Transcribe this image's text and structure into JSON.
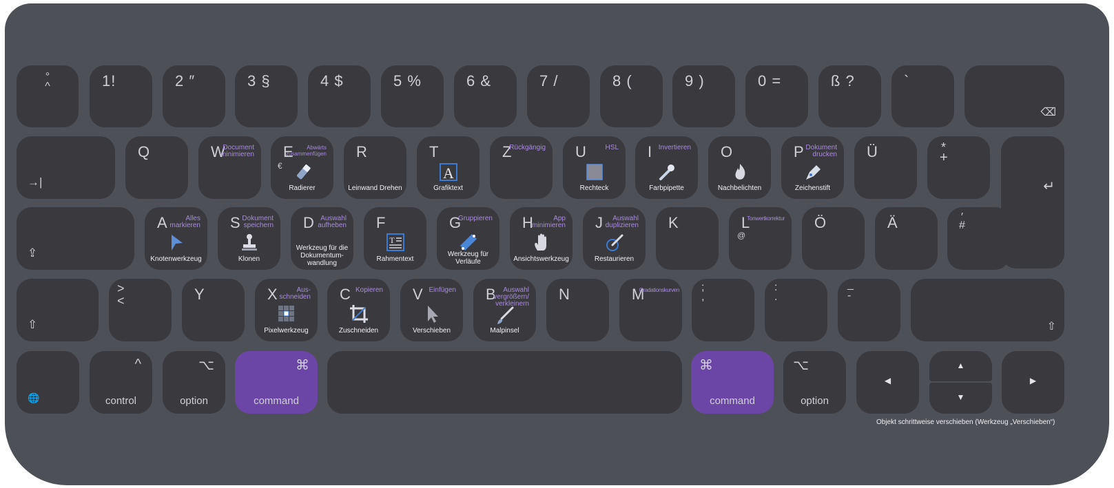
{
  "keys": {
    "circ": {
      "top": "°",
      "bottom": "^"
    },
    "k1": "1!",
    "k2": "2 ″",
    "k3": "3 §",
    "k4": "4 $",
    "k5": "5 %",
    "k6": "6 &",
    "k7": "7 /",
    "k8": "8 (",
    "k9": "9 )",
    "k0": "0 =",
    "kss": "ß ?",
    "kacc": "`",
    "q": "Q",
    "w": {
      "cap": "W",
      "shortcut": "Document\nminimieren"
    },
    "e": {
      "cap": "E",
      "shortcut": "Abwärts\nzusammenfügen",
      "alt": "€",
      "tool": "Radierer"
    },
    "r": {
      "cap": "R",
      "tool": "Leinwand Drehen"
    },
    "t": {
      "cap": "T",
      "tool": "Grafiktext"
    },
    "z": {
      "cap": "Z",
      "shortcut": "Rückgängig"
    },
    "u": {
      "cap": "U",
      "shortcut": "HSL",
      "tool": "Rechteck"
    },
    "i": {
      "cap": "I",
      "shortcut": "Invertieren",
      "tool": "Farbpipette"
    },
    "o": {
      "cap": "O",
      "tool": "Nachbelichten"
    },
    "p": {
      "cap": "P",
      "shortcut": "Dokument\ndrucken",
      "tool": "Zeichenstift"
    },
    "ue": "Ü",
    "plus": {
      "top": "*",
      "bottom": "+"
    },
    "a": {
      "cap": "A",
      "shortcut": "Alles\nmarkieren",
      "tool": "Knotenwerkzeug"
    },
    "s": {
      "cap": "S",
      "shortcut": "Dokument\nspeichern",
      "tool": "Klonen"
    },
    "d": {
      "cap": "D",
      "shortcut": "Auswahl\naufheben",
      "tool": "Werkzeug für die\nDokumentum-\nwandlung"
    },
    "f": {
      "cap": "F",
      "tool": "Rahmentext"
    },
    "g": {
      "cap": "G",
      "shortcut": "Gruppieren",
      "tool": "Werkzeug für\nVerläufe"
    },
    "h": {
      "cap": "H",
      "shortcut": "App\nminimieren",
      "tool": "Ansichtswerkzeug"
    },
    "j": {
      "cap": "J",
      "shortcut": "Auswahl\nduplizieren",
      "tool": "Restaurieren"
    },
    "k": "K",
    "l": {
      "cap": "L",
      "shortcut": "Tonwertkorrektur",
      "alt": "@"
    },
    "oe": "Ö",
    "ae": "Ä",
    "hash": {
      "top": "′",
      "bottom": "#"
    },
    "lt": {
      "top": ">",
      "bottom": "<"
    },
    "y": "Y",
    "x": {
      "cap": "X",
      "shortcut": "Aus-\nschneiden",
      "tool": "Pixelwerkzeug"
    },
    "c": {
      "cap": "C",
      "shortcut": "Kopieren",
      "tool": "Zuschneiden"
    },
    "v": {
      "cap": "V",
      "shortcut": "Einfügen",
      "tool": "Verschieben"
    },
    "b": {
      "cap": "B",
      "shortcut": "Auswahl\nvergrößern/\nverkleinern",
      "tool": "Malpinsel"
    },
    "n": "N",
    "m": {
      "cap": "M",
      "shortcut": "Gradationskurven"
    },
    "semi": {
      "top": ";",
      "bottom": ","
    },
    "colon": {
      "top": ":",
      "bottom": "."
    },
    "dash": {
      "top": "_",
      "bottom": "-"
    },
    "control": {
      "sym": "^",
      "label": "control"
    },
    "optionL": {
      "sym": "⌥",
      "label": "option"
    },
    "commandL": {
      "sym": "⌘",
      "label": "command"
    },
    "commandR": {
      "sym": "⌘",
      "label": "command"
    },
    "optionR": {
      "sym": "⌥",
      "label": "option"
    },
    "up": "▲",
    "down": "▼",
    "left": "◀",
    "right": "▶",
    "tab": "→|",
    "return": "↵",
    "backspace": "⌫",
    "caps": "⇪",
    "shift": "⇧",
    "globe": "🌐"
  },
  "footnote": "Objekt schrittweise verschieben (Werkzeug „Verschieben“)",
  "colors": {
    "board": "#4e5057",
    "key": "#39393e",
    "accent": "#6b46a6",
    "shortcut": "#a98be0"
  }
}
